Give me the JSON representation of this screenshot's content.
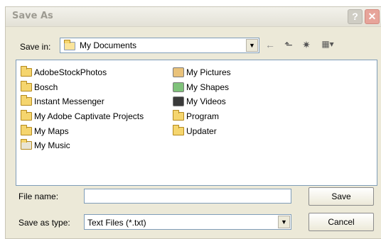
{
  "window": {
    "title": "Save As"
  },
  "title_buttons": {
    "help": "?",
    "close": "✕"
  },
  "save_in": {
    "label": "Save in:",
    "value": "My Documents"
  },
  "toolbar": {
    "back_glyph": "←",
    "up_glyph": "⬑",
    "new_folder_glyph": "✷",
    "view_glyph": "▦▾"
  },
  "files": [
    {
      "name": "AdobeStockPhotos",
      "icon": "folder-icon"
    },
    {
      "name": "Bosch",
      "icon": "folder-icon"
    },
    {
      "name": "Instant Messenger",
      "icon": "folder-icon"
    },
    {
      "name": "My Adobe Captivate Projects",
      "icon": "folder-icon"
    },
    {
      "name": "My Maps",
      "icon": "folder-icon"
    },
    {
      "name": "My Music",
      "icon": "music-folder-icon"
    },
    {
      "name": "My Pictures",
      "icon": "pictures-folder-icon"
    },
    {
      "name": "My Shapes",
      "icon": "shapes-folder-icon"
    },
    {
      "name": "My Videos",
      "icon": "videos-folder-icon"
    },
    {
      "name": "Program",
      "icon": "folder-icon"
    },
    {
      "name": "Updater",
      "icon": "folder-icon"
    }
  ],
  "file_name": {
    "label": "File name:",
    "value": ""
  },
  "save_as_type": {
    "label": "Save as type:",
    "value": "Text Files (*.txt)"
  },
  "buttons": {
    "save": "Save",
    "cancel": "Cancel"
  },
  "colors": {
    "dialog_bg": "#ece9d8",
    "field_border": "#7f9db9",
    "folder_yellow": "#f5d56e"
  }
}
